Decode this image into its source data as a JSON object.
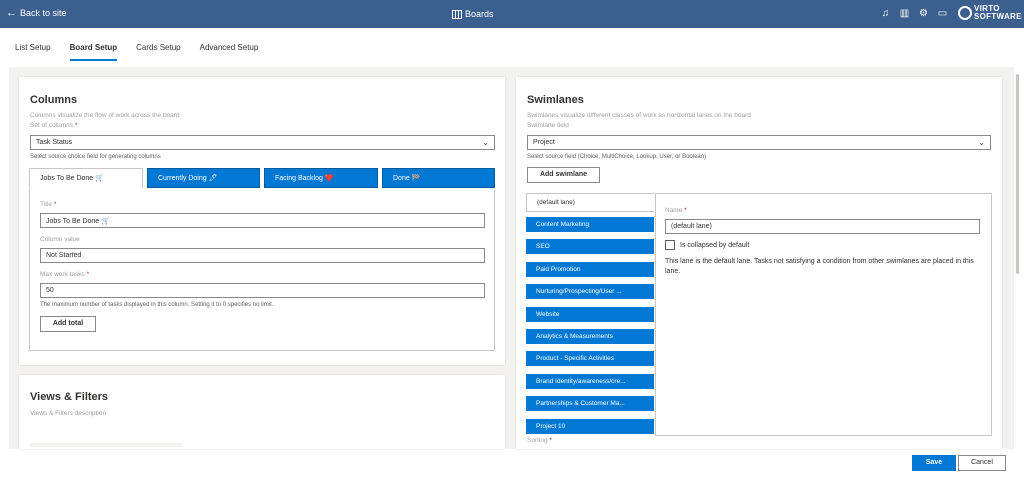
{
  "topbar": {
    "back_label": "Back to site",
    "title": "Boards",
    "icons": [
      "bell-icon",
      "book-icon",
      "gear-icon",
      "feedback-icon"
    ],
    "logo_line1": "VIRTO",
    "logo_line2": "SOFTWARE"
  },
  "nav_tabs": [
    {
      "label": "List Setup"
    },
    {
      "label": "Board Setup",
      "active": true
    },
    {
      "label": "Cards Setup"
    },
    {
      "label": "Advanced Setup"
    }
  ],
  "columns": {
    "heading": "Columns",
    "description": "Columns visualize the flow of work across the board",
    "set_label": "Set of columns",
    "required_mark": "*",
    "set_value": "Task Status",
    "set_hint": "Select source choice field for generating columns",
    "tabs": [
      {
        "label": "Jobs To Be Done 🛒"
      },
      {
        "label": "Currently Doing 🖊"
      },
      {
        "label": "Facing Backlog ❤️"
      },
      {
        "label": "Done 🏁"
      }
    ],
    "title_label": "Title",
    "title_value": "Jobs To Be Done 🛒",
    "column_value_label": "Column value",
    "column_value": "Not Started",
    "max_label": "Max work tasks",
    "max_value": "50",
    "max_hint": "The maximum number of tasks displayed in this column. Setting it to 0 specifies no limit.",
    "add_total_label": "Add total"
  },
  "views": {
    "heading": "Views & Filters",
    "description": "Views & Filters description"
  },
  "swimlanes": {
    "heading": "Swimlanes",
    "description": "Swimlanes visualize different classes of work as horizontal lanes on the board",
    "field_label": "Swimlane field",
    "field_value": "Project",
    "field_hint": "Select source field (Choice, MultiChoice, Lookup, User, or Boolean)",
    "add_label": "Add swimlane",
    "lanes": [
      "(default lane)",
      "Content Marketing",
      "SEO",
      "Paid Promotion",
      "Nurturing/Prospecting/User ...",
      "Website",
      "Analytics & Measurements",
      "Product - Specific Activities",
      "Brand Identity/awareness/cre...",
      "Partnerships & Customer Ma...",
      "Project 10"
    ],
    "name_label": "Name",
    "name_value": "(default lane)",
    "collapsed_label": "Is collapsed by default",
    "default_note": "This lane is the default lane. Tasks not satisfying a condition from other swimlanes are placed in this lane.",
    "sorting_label": "Sorting"
  },
  "footer": {
    "save_label": "Save",
    "cancel_label": "Cancel"
  }
}
